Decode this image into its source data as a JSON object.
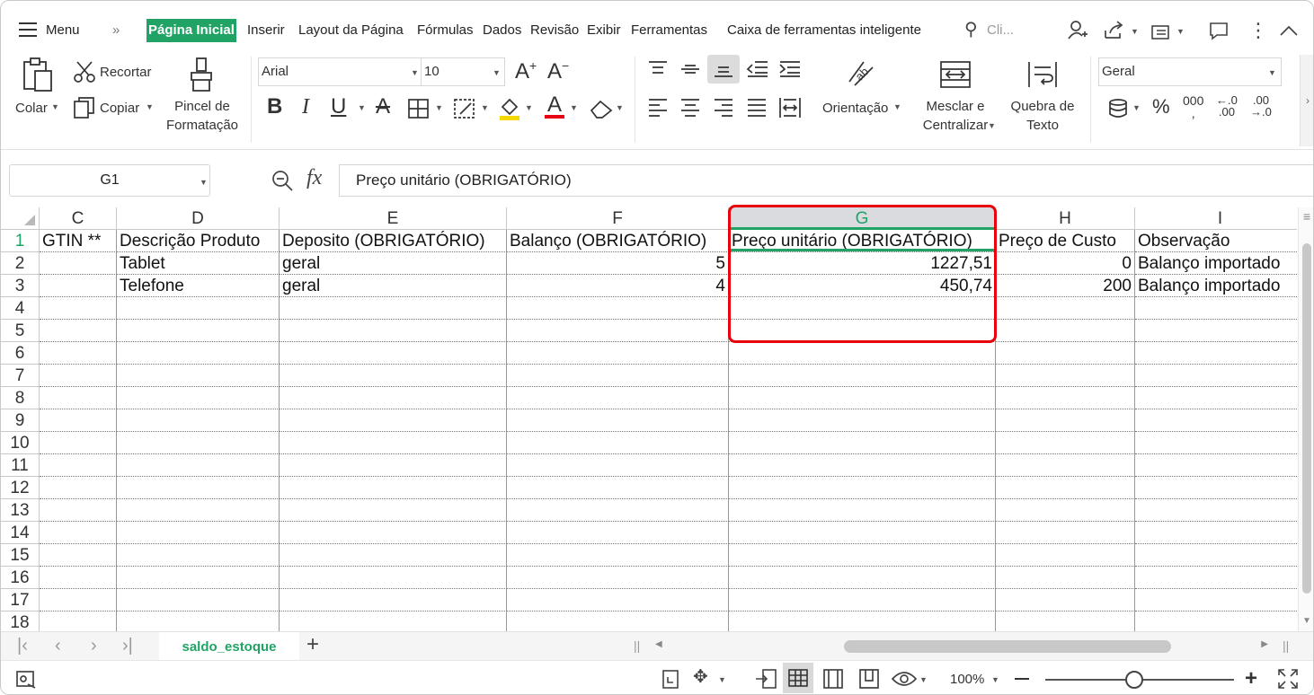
{
  "menubar": {
    "menu_label": "Menu",
    "tabs": [
      "Página Inicial",
      "Inserir",
      "Layout da Página",
      "Fórmulas",
      "Dados",
      "Revisão",
      "Exibir",
      "Ferramentas",
      "Caixa de ferramentas inteligente"
    ],
    "active_tab": "Página Inicial",
    "search_placeholder": "Cli..."
  },
  "ribbon": {
    "paste_label": "Colar",
    "cut_label": "Recortar",
    "copy_label": "Copiar",
    "format_painter_label": [
      "Pincel de",
      "Formatação"
    ],
    "font_name": "Arial",
    "font_size": "10",
    "orientation_label": "Orientação",
    "merge_label": [
      "Mesclar e",
      "Centralizar"
    ],
    "wrap_label": [
      "Quebra de",
      "Texto"
    ],
    "number_format": "Geral",
    "thousands_label": "000",
    "inc_decimal_label": ".0\n.00",
    "dec_decimal_label": ".00\n.0"
  },
  "formula_bar": {
    "name_box": "G1",
    "fx": "fx",
    "content": "Preço unitário (OBRIGATÓRIO)"
  },
  "sheet": {
    "columns": [
      {
        "letter": "C"
      },
      {
        "letter": "D"
      },
      {
        "letter": "E"
      },
      {
        "letter": "F"
      },
      {
        "letter": "G"
      },
      {
        "letter": "H"
      },
      {
        "letter": "I"
      }
    ],
    "selected_column": "G",
    "rows": [
      [
        "GTIN **",
        "Descrição Produto",
        "Deposito (OBRIGATÓRIO)",
        "Balanço (OBRIGATÓRIO)",
        "Preço unitário (OBRIGATÓRIO)",
        "Preço de Custo",
        "Observação"
      ],
      [
        "",
        "Tablet",
        "geral",
        "5",
        "1227,51",
        "0",
        "Balanço importado"
      ],
      [
        "",
        "Telefone",
        "geral",
        "4",
        "450,74",
        "200",
        "Balanço importado"
      ]
    ],
    "row_numbers": [
      "1",
      "2",
      "3",
      "4",
      "5",
      "6",
      "7",
      "8",
      "9",
      "10",
      "11",
      "12",
      "13",
      "14",
      "15",
      "16",
      "17",
      "18"
    ],
    "numeric_columns": [
      "F",
      "G",
      "H"
    ]
  },
  "sheet_tabs": {
    "active": "saldo_estoque",
    "add_label": "+"
  },
  "statusbar": {
    "zoom": "100%",
    "zoom_fraction": 0.47
  }
}
